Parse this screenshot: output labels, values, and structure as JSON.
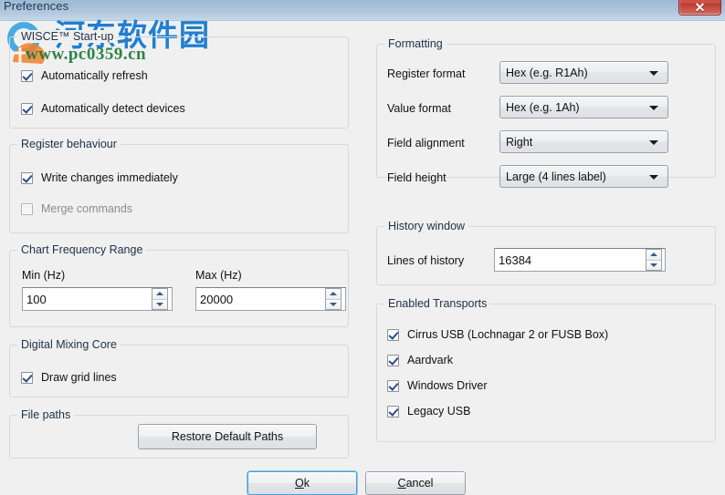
{
  "window": {
    "title": "Preferences",
    "close_label": "✕",
    "accent_titlebar": "#a9c2da",
    "accent_close": "#c0443c",
    "background": "#f0f0f0"
  },
  "watermark": {
    "site_cn": "河东软件园",
    "url": "www.pc0359.cn",
    "logo_color": "#1f7fd0",
    "url_color": "#1f7a3a"
  },
  "left": {
    "startup": {
      "legend": "WISCE™ Start-up",
      "items": [
        {
          "label": "Automatically refresh",
          "checked": true,
          "enabled": true
        },
        {
          "label": "Automatically detect devices",
          "checked": true,
          "enabled": true
        }
      ]
    },
    "register_behaviour": {
      "legend": "Register behaviour",
      "items": [
        {
          "label": "Write changes immediately",
          "checked": true,
          "enabled": true
        },
        {
          "label": "Merge commands",
          "checked": false,
          "enabled": false
        }
      ]
    },
    "chart_frequency_range": {
      "legend": "Chart Frequency Range",
      "min_label": "Min (Hz)",
      "min_value": "100",
      "max_label": "Max (Hz)",
      "max_value": "20000"
    },
    "digital_mixing_core": {
      "legend": "Digital Mixing Core",
      "items": [
        {
          "label": "Draw grid lines",
          "checked": true,
          "enabled": true
        }
      ]
    },
    "file_paths": {
      "legend": "File paths",
      "restore_button": "Restore Default Paths"
    }
  },
  "right": {
    "formatting": {
      "legend": "Formatting",
      "fields": [
        {
          "label": "Register format",
          "value": "Hex (e.g. R1Ah)"
        },
        {
          "label": "Value format",
          "value": "Hex (e.g. 1Ah)"
        },
        {
          "label": "Field alignment",
          "value": "Right"
        },
        {
          "label": "Field height",
          "value": "Large (4 lines label)"
        }
      ]
    },
    "history_window": {
      "legend": "History window",
      "lines_label": "Lines of history",
      "lines_value": "16384"
    },
    "enabled_transports": {
      "legend": "Enabled Transports",
      "items": [
        {
          "label": "Cirrus USB (Lochnagar 2 or FUSB Box)",
          "checked": true
        },
        {
          "label": "Aardvark",
          "checked": true
        },
        {
          "label": "Windows Driver",
          "checked": true
        },
        {
          "label": "Legacy USB",
          "checked": true
        }
      ]
    }
  },
  "footer": {
    "ok_prefix": "O",
    "ok_rest": "k",
    "cancel_prefix": "C",
    "cancel_rest": "ancel"
  }
}
